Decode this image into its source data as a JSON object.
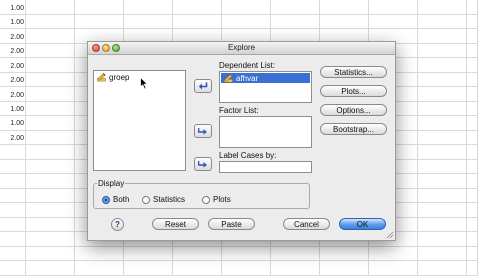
{
  "spreadsheet": {
    "values": [
      "1.00",
      "1.00",
      "2.00",
      "2.00",
      "2.00",
      "2.00",
      "2.00",
      "1.00",
      "1.00",
      "2.00"
    ]
  },
  "dialog": {
    "title": "Explore",
    "source_list": {
      "items": [
        {
          "label": "groep",
          "icon": "ruler-pencil-icon"
        }
      ]
    },
    "dependent_list": {
      "label": "Dependent List:",
      "items": [
        {
          "label": "afhvar",
          "icon": "ruler-pencil-icon",
          "selected": true
        }
      ]
    },
    "factor_list": {
      "label": "Factor List:"
    },
    "label_cases": {
      "label": "Label Cases by:",
      "value": ""
    },
    "side_buttons": {
      "statistics": "Statistics...",
      "plots": "Plots...",
      "options": "Options...",
      "bootstrap": "Bootstrap..."
    },
    "display": {
      "label": "Display",
      "options": [
        {
          "label": "Both",
          "selected": true
        },
        {
          "label": "Statistics",
          "selected": false
        },
        {
          "label": "Plots",
          "selected": false
        }
      ]
    },
    "footer": {
      "help": "?",
      "reset": "Reset",
      "paste": "Paste",
      "cancel": "Cancel",
      "ok": "OK"
    }
  },
  "colors": {
    "selection": "#3a6fd3",
    "default_button": "#5d9cec",
    "dialog_bg": "#ececec"
  }
}
